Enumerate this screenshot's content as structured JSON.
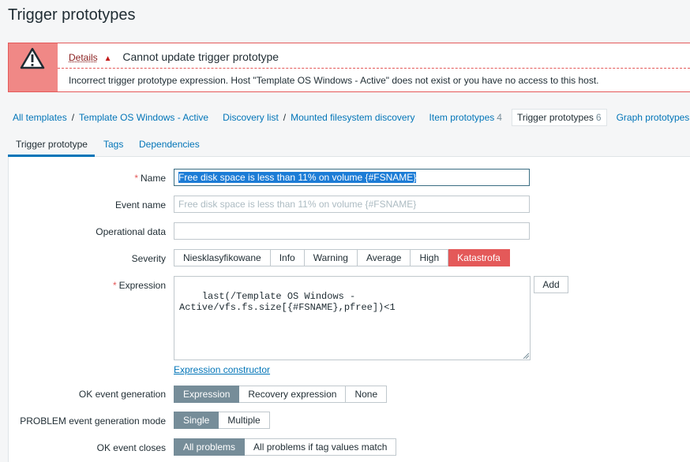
{
  "page_title": "Trigger prototypes",
  "message": {
    "details_label": "Details",
    "title": "Cannot update trigger prototype",
    "detail": "Incorrect trigger prototype expression. Host \"Template OS Windows - Active\" does not exist or you have no access to this host."
  },
  "breadcrumb": {
    "all_templates": "All templates",
    "template": "Template OS Windows - Active",
    "discovery_list": "Discovery list",
    "discovery_rule": "Mounted filesystem discovery",
    "item_prototypes": "Item prototypes",
    "item_prototypes_count": "4",
    "trigger_prototypes": "Trigger prototypes",
    "trigger_prototypes_count": "6",
    "graph_prototypes": "Graph prototypes"
  },
  "tabs": {
    "trigger_prototype": "Trigger prototype",
    "tags": "Tags",
    "dependencies": "Dependencies"
  },
  "form": {
    "name_label": "Name",
    "name_value": "Free disk space is less than 11% on volume {#FSNAME}",
    "event_name_label": "Event name",
    "event_name_placeholder": "Free disk space is less than 11% on volume {#FSNAME}",
    "operational_data_label": "Operational data",
    "severity_label": "Severity",
    "severity_options": [
      "Niesklasyfikowane",
      "Info",
      "Warning",
      "Average",
      "High",
      "Katastrofa"
    ],
    "severity_selected": "Katastrofa",
    "expression_label": "Expression",
    "expression_value": "last(/Template OS Windows -\nActive/vfs.fs.size[{#FSNAME},pfree])<1",
    "add_button": "Add",
    "expression_constructor": "Expression constructor",
    "ok_event_generation_label": "OK event generation",
    "ok_event_generation_options": [
      "Expression",
      "Recovery expression",
      "None"
    ],
    "ok_event_generation_selected": "Expression",
    "problem_mode_label": "PROBLEM event generation mode",
    "problem_mode_options": [
      "Single",
      "Multiple"
    ],
    "problem_mode_selected": "Single",
    "ok_event_closes_label": "OK event closes",
    "ok_event_closes_options": [
      "All problems",
      "All problems if tag values match"
    ],
    "ok_event_closes_selected": "All problems"
  },
  "colors": {
    "accent": "#0275b8",
    "error": "#e45959",
    "selected_segment": "#768d99"
  }
}
